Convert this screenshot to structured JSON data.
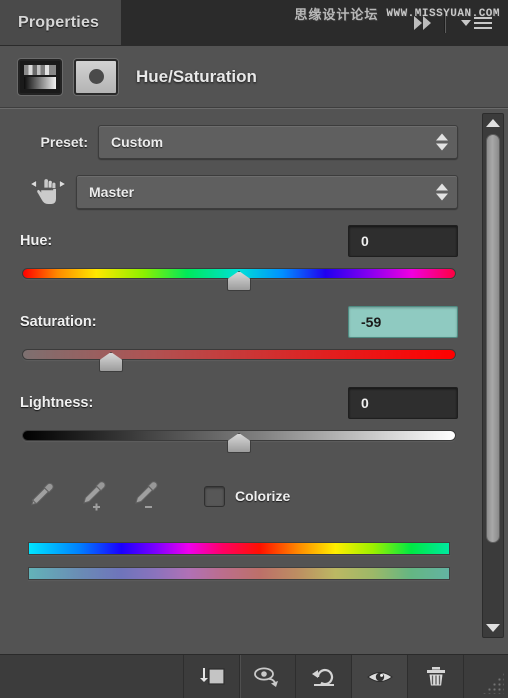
{
  "panel": {
    "tab_label": "Properties",
    "collapse_icon": "double-chevron-right-icon",
    "menu_icon": "panel-menu-icon"
  },
  "watermark": {
    "chinese": "思缘设计论坛",
    "url": "WWW.MISSYUAN.COM"
  },
  "header": {
    "adjustment_thumb_icon": "hue-saturation-adjustment-thumbnail",
    "mask_thumb_icon": "layer-mask-thumbnail",
    "title": "Hue/Saturation"
  },
  "preset": {
    "label": "Preset:",
    "value": "Custom",
    "stepper_icon": "stepper-up-down-icon"
  },
  "channel": {
    "targeted_tool_icon": "on-image-adjustment-hand-icon",
    "value": "Master",
    "stepper_icon": "stepper-up-down-icon"
  },
  "sliders": [
    {
      "name": "hue",
      "label": "Hue:",
      "value": "0",
      "selected": false,
      "thumb_percent": 50,
      "track": "hue-spectrum"
    },
    {
      "name": "saturation",
      "label": "Saturation:",
      "value": "-59",
      "selected": true,
      "thumb_percent": 20.5,
      "track": "saturation-red"
    },
    {
      "name": "lightness",
      "label": "Lightness:",
      "value": "0",
      "selected": false,
      "thumb_percent": 50,
      "track": "lightness-black-white"
    }
  ],
  "tools": {
    "eyedropper_icon": "eyedropper-icon",
    "eyedropper_add_icon": "eyedropper-add-icon",
    "eyedropper_subtract_icon": "eyedropper-subtract-icon",
    "colorize_label": "Colorize",
    "colorize_checked": false,
    "checkbox_icon": "checkbox-unchecked-icon"
  },
  "spectrums": {
    "source_name": "source-color-spectrum",
    "result_name": "result-color-spectrum"
  },
  "scrollbar": {
    "up_icon": "scroll-up-arrow-icon",
    "down_icon": "scroll-down-arrow-icon",
    "thumb_name": "scrollbar-thumb"
  },
  "footer": {
    "buttons": [
      {
        "name": "clip-to-layer-button",
        "icon": "clip-to-layer-icon"
      },
      {
        "name": "toggle-last-state-button",
        "icon": "eye-rotate-icon"
      },
      {
        "name": "reset-adjustment-button",
        "icon": "reset-arrow-icon"
      },
      {
        "name": "toggle-visibility-button",
        "icon": "eye-icon"
      },
      {
        "name": "delete-adjustment-button",
        "icon": "trash-icon"
      }
    ],
    "grip_icon": "resize-grip-icon"
  },
  "colors": {
    "panel_bg": "#535353",
    "tabbar_bg": "#2b2b2b",
    "tab_active_bg": "#4a4a4a",
    "footer_bg": "#3c3c3c",
    "field_bg": "#2e2e2e",
    "selection_highlight": "#8fcac1",
    "text": "#efefef"
  }
}
